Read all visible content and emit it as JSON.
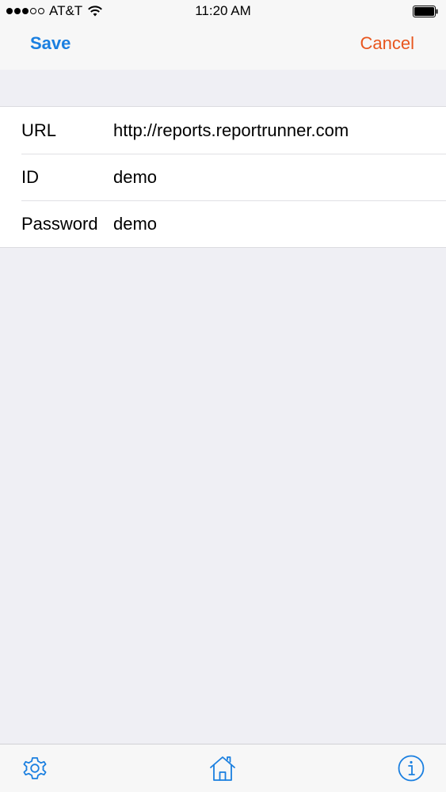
{
  "status_bar": {
    "carrier": "AT&T",
    "time": "11:20 AM"
  },
  "nav": {
    "save_label": "Save",
    "cancel_label": "Cancel"
  },
  "form": {
    "rows": [
      {
        "label": "URL",
        "value": "http://reports.reportrunner.com"
      },
      {
        "label": "ID",
        "value": "demo"
      },
      {
        "label": "Password",
        "value": "demo"
      }
    ]
  },
  "tab_bar": {
    "items": [
      {
        "icon": "gear-icon"
      },
      {
        "icon": "home-icon"
      },
      {
        "icon": "info-icon"
      }
    ]
  },
  "colors": {
    "save": "#1a7fe0",
    "cancel": "#e8561e",
    "tab_icon": "#1a7fe0",
    "background": "#efeff4"
  }
}
